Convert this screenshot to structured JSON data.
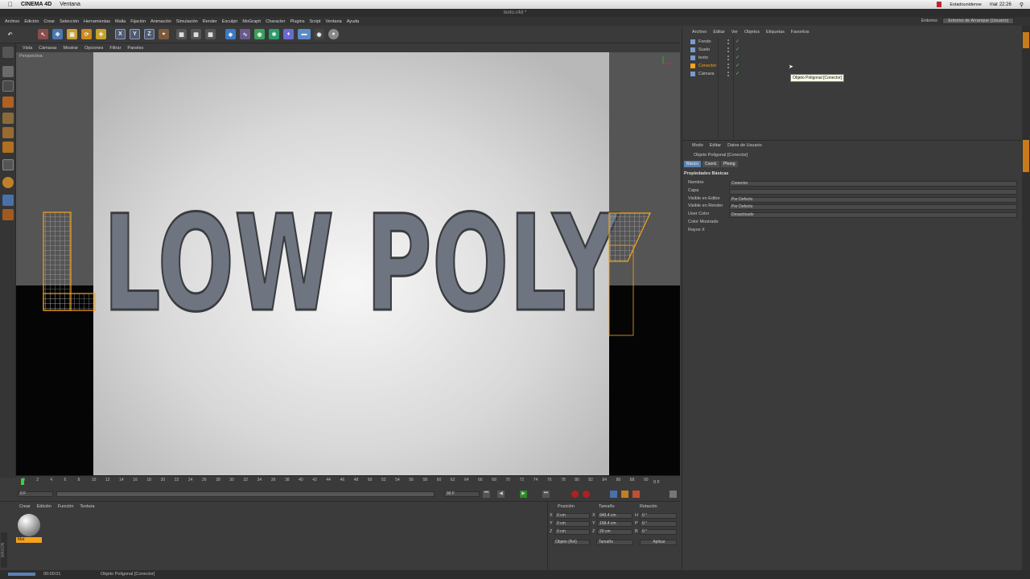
{
  "macos": {
    "app_name": "CINEMA 4D",
    "menu_window": "Ventana",
    "keyboard": "Estadounidense",
    "clock": "mar 22:26"
  },
  "window": {
    "title": "texto.c4d *"
  },
  "main_menu": [
    "Archivo",
    "Edición",
    "Crear",
    "Selección",
    "Herramientas",
    "Malla",
    "Fijación",
    "Animación",
    "Simulación",
    "Render",
    "Esculpir",
    "MoGraph",
    "Character",
    "Plugins",
    "Script",
    "Ventana",
    "Ayuda"
  ],
  "layout": {
    "label": "Entorno:",
    "value": "Entorno de Arranque (Usuario)"
  },
  "viewport": {
    "menu": [
      "Vista",
      "Cámaras",
      "Mostrar",
      "Opciones",
      "Filtrar",
      "Paneles"
    ],
    "label": "Perspectiva",
    "scene_text": "LOW POLY"
  },
  "timeline": {
    "ticks": [
      "0",
      "2",
      "4",
      "6",
      "8",
      "10",
      "12",
      "14",
      "16",
      "18",
      "20",
      "22",
      "24",
      "26",
      "28",
      "30",
      "32",
      "34",
      "36",
      "38",
      "40",
      "42",
      "44",
      "46",
      "48",
      "50",
      "52",
      "54",
      "56",
      "58",
      "60",
      "62",
      "64",
      "66",
      "68",
      "70",
      "72",
      "74",
      "76",
      "78",
      "80",
      "82",
      "84",
      "86",
      "88",
      "90"
    ],
    "current_frame": "0 F",
    "start_field": "0 F",
    "end_field": "90 F",
    "min_field": "0 F"
  },
  "material_manager": {
    "menu": [
      "Crear",
      "Edición",
      "Función",
      "Textura"
    ],
    "material_name": "Mat"
  },
  "coordinates": {
    "headers": [
      "Posición",
      "Tamaño",
      "Rotación"
    ],
    "rows": [
      {
        "pos_axis": "X",
        "pos": "0 cm",
        "size_axis": "X",
        "size": "949.4 cm",
        "rot_axis": "H",
        "rot": "0 °"
      },
      {
        "pos_axis": "Y",
        "pos": "0 cm",
        "size_axis": "Y",
        "size": "158.4 cm",
        "rot_axis": "P",
        "rot": "0 °"
      },
      {
        "pos_axis": "Z",
        "pos": "0 cm",
        "size_axis": "Z",
        "size": "20 cm",
        "rot_axis": "B",
        "rot": "0 °"
      }
    ],
    "mode_select": "Objeto (Rel)",
    "size_select": "Tamaño",
    "apply_button": "Aplicar"
  },
  "object_manager": {
    "menu": [
      "Archivo",
      "Editar",
      "Ver",
      "Objetos",
      "Etiquetas",
      "Favoritos"
    ],
    "objects": [
      {
        "name": "Fondo",
        "selected": false
      },
      {
        "name": "Suelo",
        "selected": false
      },
      {
        "name": "texto",
        "selected": false
      },
      {
        "name": "Conector",
        "selected": true
      },
      {
        "name": "Cámara",
        "selected": false
      }
    ],
    "tooltip": "Objeto Poligonal [Conector]"
  },
  "attribute_manager": {
    "menu": [
      "Modo",
      "Editar",
      "Datos de Usuario"
    ],
    "object_title": "Objeto Poligonal [Conector]",
    "tabs": [
      "Básico",
      "Coord.",
      "Phong"
    ],
    "section": "Propiedades Básicas",
    "props": [
      {
        "label": "Nombre",
        "value": "Conector"
      },
      {
        "label": "Capa",
        "value": ""
      },
      {
        "label": "Visible en Editor",
        "value": "Por Defecto"
      },
      {
        "label": "Visible en Render",
        "value": "Por Defecto"
      },
      {
        "label": "User Color",
        "value": "Desactivado"
      },
      {
        "label": "Color Mostrado",
        "value": ""
      },
      {
        "label": "Rayos X",
        "value": ""
      }
    ]
  },
  "status_bar": {
    "time": "00:00:01",
    "message": "Objeto Poligonal [Conector]"
  },
  "colors": {
    "accent_orange": "#f7a21b",
    "selected_blue": "#5a82b4",
    "panel": "#3b3b3b"
  }
}
